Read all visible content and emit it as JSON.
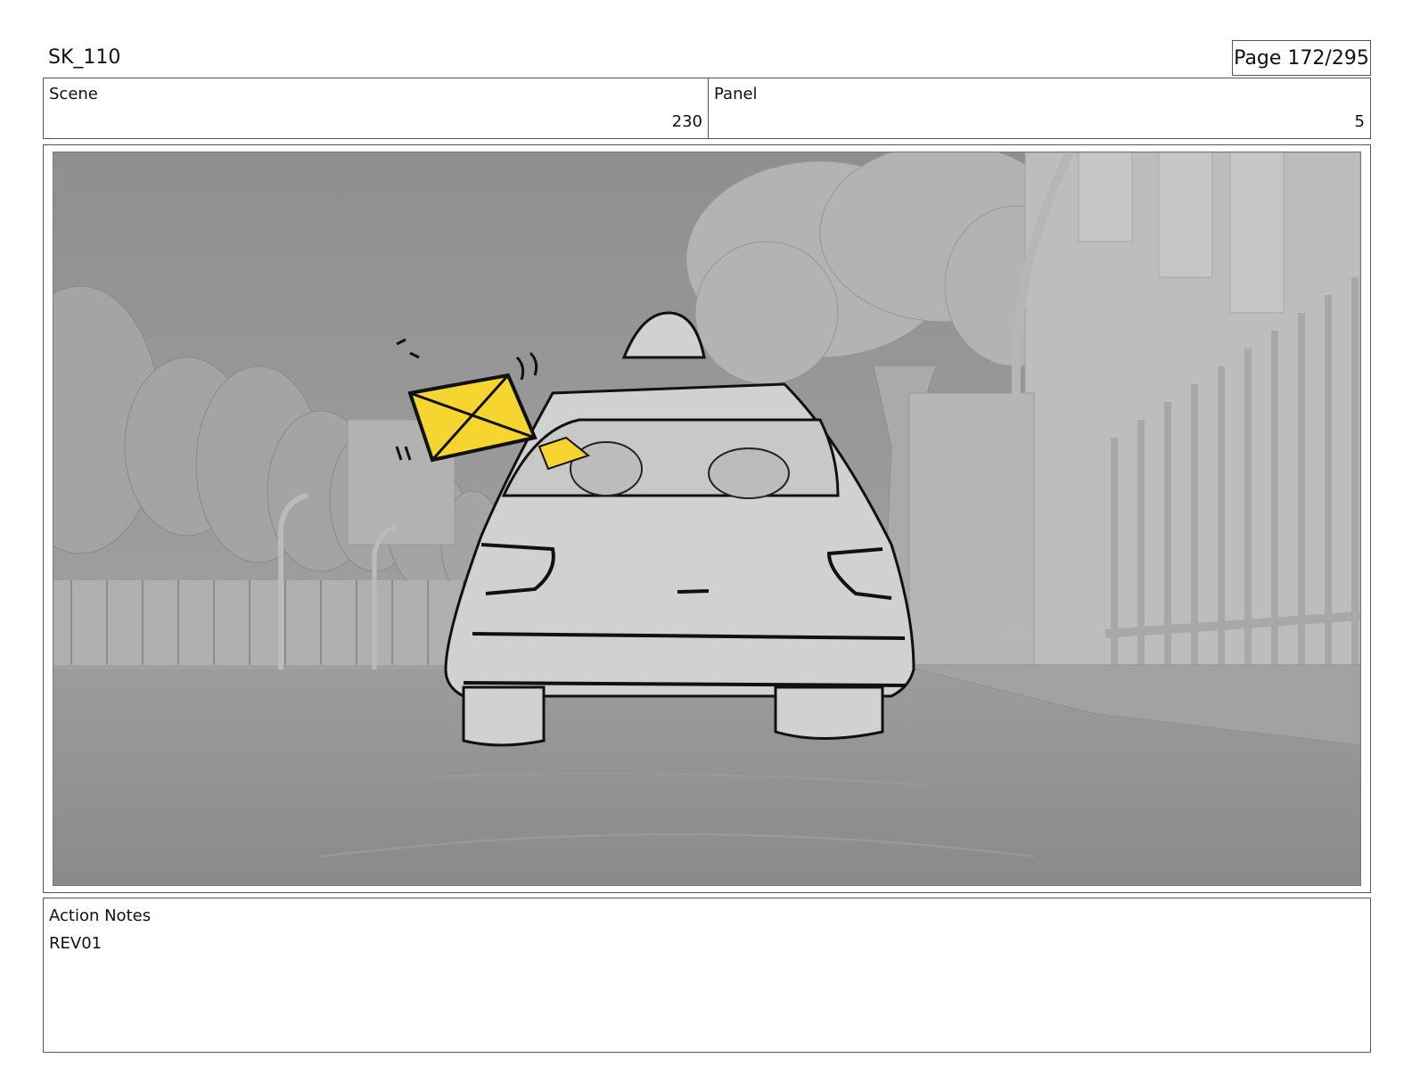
{
  "header": {
    "doc_id": "SK_110",
    "page_label": "Page 172/295"
  },
  "info": {
    "scene_label": "Scene",
    "scene_value": "230",
    "panel_label": "Panel",
    "panel_value": "5"
  },
  "frame": {
    "description_icon": "storyboard-drawing"
  },
  "notes": {
    "label": "Action Notes",
    "text": "REV01"
  },
  "colors": {
    "accent_yellow": "#f7d531",
    "background_gray": "#a9a9a9"
  }
}
